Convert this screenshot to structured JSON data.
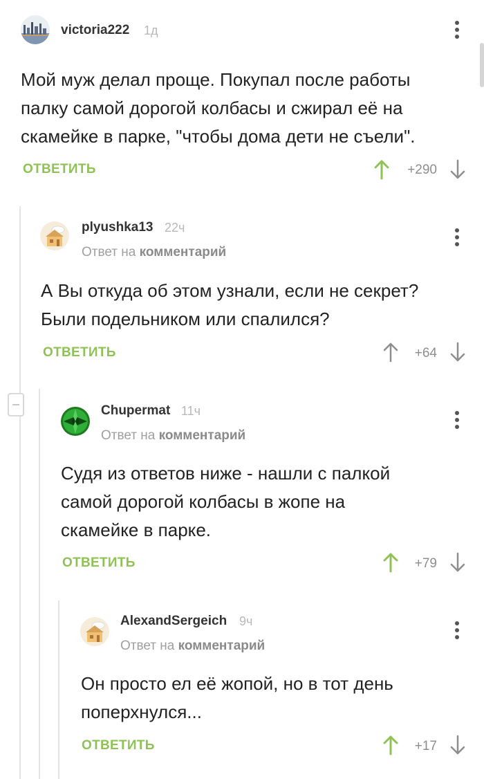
{
  "colors": {
    "accent": "#8fc255",
    "upvote_active": "#8fc255",
    "upvote_inactive": "#8d8d8d"
  },
  "comments": [
    {
      "username": "victoria222",
      "time": "1д",
      "avatar_icon": "city-skyline-avatar",
      "text": [
        "Мой муж делал проще. Покупал после работы",
        "палку самой дорогой колбасы и сжирал её на",
        "скамейке в парке, \"чтобы дома дети не съели\"."
      ],
      "reply_label": "ОТВЕТИТЬ",
      "score": "+290",
      "upvoted": true
    },
    {
      "username": "plyushka13",
      "time": "22ч",
      "reply_prefix": "Ответ на",
      "reply_target": "комментарий",
      "avatar_icon": "house-cartoon-avatar",
      "text": [
        "А Вы откуда об этом узнали, если не секрет?",
        "Были подельником или спалился?"
      ],
      "reply_label": "ОТВЕТИТЬ",
      "score": "+64",
      "upvoted": false
    },
    {
      "username": "Chupermat",
      "time": "11ч",
      "reply_prefix": "Ответ на",
      "reply_target": "комментарий",
      "avatar_icon": "green-leaves-avatar",
      "text": [
        "Судя из ответов ниже - нашли с палкой",
        "самой дорогой колбасы в жопе на",
        "скамейке в парке."
      ],
      "reply_label": "ОТВЕТИТЬ",
      "score": "+79",
      "upvoted": true
    },
    {
      "username": "AlexandSergeich",
      "time": "9ч",
      "reply_prefix": "Ответ на",
      "reply_target": "комментарий",
      "avatar_icon": "house-cartoon-avatar",
      "text": [
        "Он просто ел её жопой, но в тот день",
        "поперхнулся..."
      ],
      "reply_label": "ОТВЕТИТЬ",
      "score": "+17",
      "upvoted": true
    }
  ]
}
